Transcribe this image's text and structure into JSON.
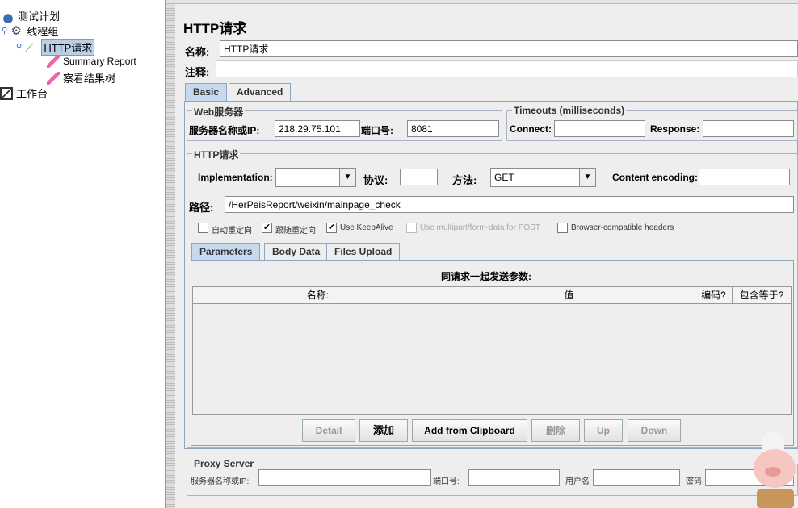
{
  "tree": {
    "items": [
      {
        "label": "测试计划",
        "icon": "test-plan-icon"
      },
      {
        "label": "线程组",
        "icon": "gear-icon"
      },
      {
        "label": "HTTP请求",
        "icon": "pipette-icon",
        "selected": true
      },
      {
        "label": "Summary Report",
        "icon": "chart-icon"
      },
      {
        "label": "察看结果树",
        "icon": "chart-icon"
      },
      {
        "label": "工作台",
        "icon": "workbench-icon"
      }
    ]
  },
  "panel": {
    "title": "HTTP请求",
    "name_label": "名称:",
    "name_value": "HTTP请求",
    "comment_label": "注释:",
    "comment_value": "",
    "tabs": [
      "Basic",
      "Advanced"
    ],
    "web_server": {
      "title": "Web服务器",
      "server_label": "服务器名称或IP:",
      "server_value": "218.29.75.101",
      "port_label": "端口号:",
      "port_value": "8081"
    },
    "timeouts": {
      "title": "Timeouts (milliseconds)",
      "connect_label": "Connect:",
      "connect_value": "",
      "response_label": "Response:",
      "response_value": ""
    },
    "http": {
      "title": "HTTP请求",
      "impl_label": "Implementation:",
      "impl_value": "",
      "protocol_label": "协议:",
      "protocol_value": "",
      "method_label": "方法:",
      "method_value": "GET",
      "encoding_label": "Content encoding:",
      "encoding_value": "",
      "path_label": "路径:",
      "path_value": "/HerPeisReport/weixin/mainpage_check"
    },
    "checkboxes": [
      {
        "label": "自动重定向",
        "checked": false
      },
      {
        "label": "跟随重定向",
        "checked": true
      },
      {
        "label": "Use KeepAlive",
        "checked": true
      },
      {
        "label": "Use multipart/form-data for POST",
        "checked": false,
        "disabled": true
      },
      {
        "label": "Browser-compatible headers",
        "checked": false
      }
    ],
    "sub_tabs": [
      "Parameters",
      "Body Data",
      "Files Upload"
    ],
    "params": {
      "title": "同请求一起发送参数:",
      "columns": [
        "名称:",
        "值",
        "编码?",
        "包含等于?"
      ],
      "rows": []
    },
    "buttons": [
      {
        "label": "Detail",
        "disabled": true
      },
      {
        "label": "添加",
        "disabled": false
      },
      {
        "label": "Add from Clipboard",
        "disabled": false
      },
      {
        "label": "删除",
        "disabled": true
      },
      {
        "label": "Up",
        "disabled": true
      },
      {
        "label": "Down",
        "disabled": true
      }
    ],
    "proxy": {
      "title": "Proxy Server",
      "server_label": "服务器名称或IP:",
      "port_label": "端口号:",
      "user_label": "用户名",
      "password_label": "密码"
    }
  }
}
